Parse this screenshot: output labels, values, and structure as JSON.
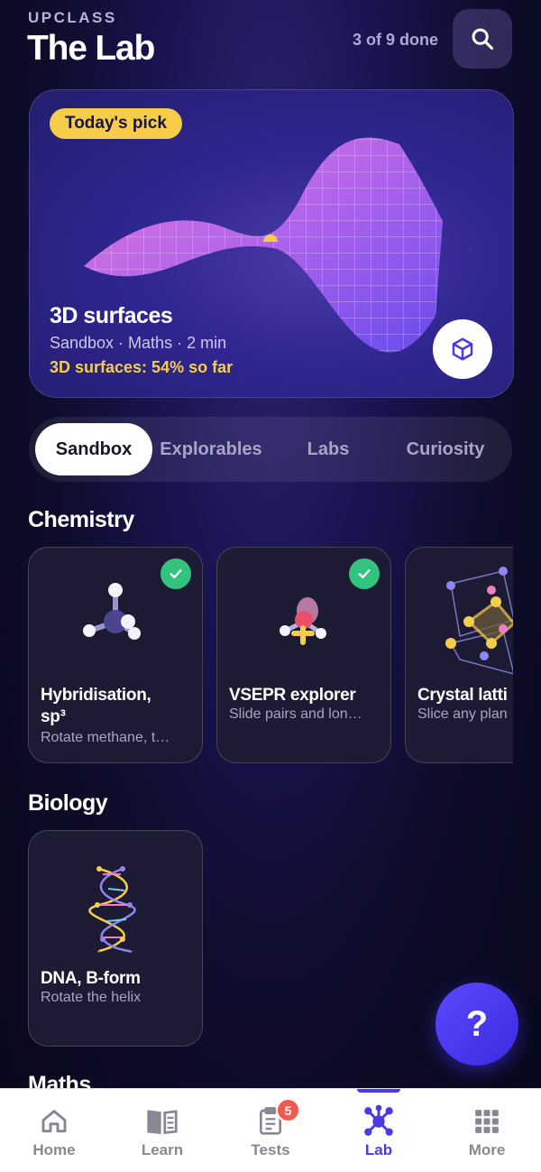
{
  "header": {
    "brand": "UPCLASS",
    "title": "The Lab",
    "progress": "3 of 9 done"
  },
  "hero": {
    "badge": "Today's pick",
    "title": "3D surfaces",
    "meta": "Sandbox · Maths · 2 min",
    "progress_text": "3D surfaces: 54% so far"
  },
  "tabs": [
    {
      "label": "Sandbox",
      "active": true
    },
    {
      "label": "Explorables",
      "active": false
    },
    {
      "label": "Labs",
      "active": false
    },
    {
      "label": "Curiosity",
      "active": false
    }
  ],
  "sections": {
    "chemistry": {
      "title": "Chemistry",
      "cards": [
        {
          "name": "Hybridisation,",
          "name2": "sp³",
          "sub": "Rotate methane, t…",
          "done": true,
          "icon": "methane-molecule-icon"
        },
        {
          "name": "VSEPR explorer",
          "sub": "Slide pairs and lon…",
          "done": true,
          "icon": "vsepr-molecule-icon"
        },
        {
          "name": "Crystal latti",
          "sub": "Slice any plan",
          "done": false,
          "icon": "crystal-lattice-icon"
        }
      ]
    },
    "biology": {
      "title": "Biology",
      "cards": [
        {
          "name": "DNA, B-form",
          "sub": "Rotate the helix",
          "icon": "dna-helix-icon"
        }
      ]
    },
    "maths": {
      "title": "Maths"
    }
  },
  "help_button": "?",
  "bottom_nav": [
    {
      "label": "Home",
      "icon": "home-icon",
      "active": false
    },
    {
      "label": "Learn",
      "icon": "book-icon",
      "active": false
    },
    {
      "label": "Tests",
      "icon": "clipboard-icon",
      "active": false,
      "badge": "5"
    },
    {
      "label": "Lab",
      "icon": "molecule-icon",
      "active": true
    },
    {
      "label": "More",
      "icon": "grid-icon",
      "active": false
    }
  ],
  "colors": {
    "accent": "#4a3ae0",
    "highlight": "#f6cd4a",
    "success": "#34c27f",
    "badge": "#f05a50"
  }
}
